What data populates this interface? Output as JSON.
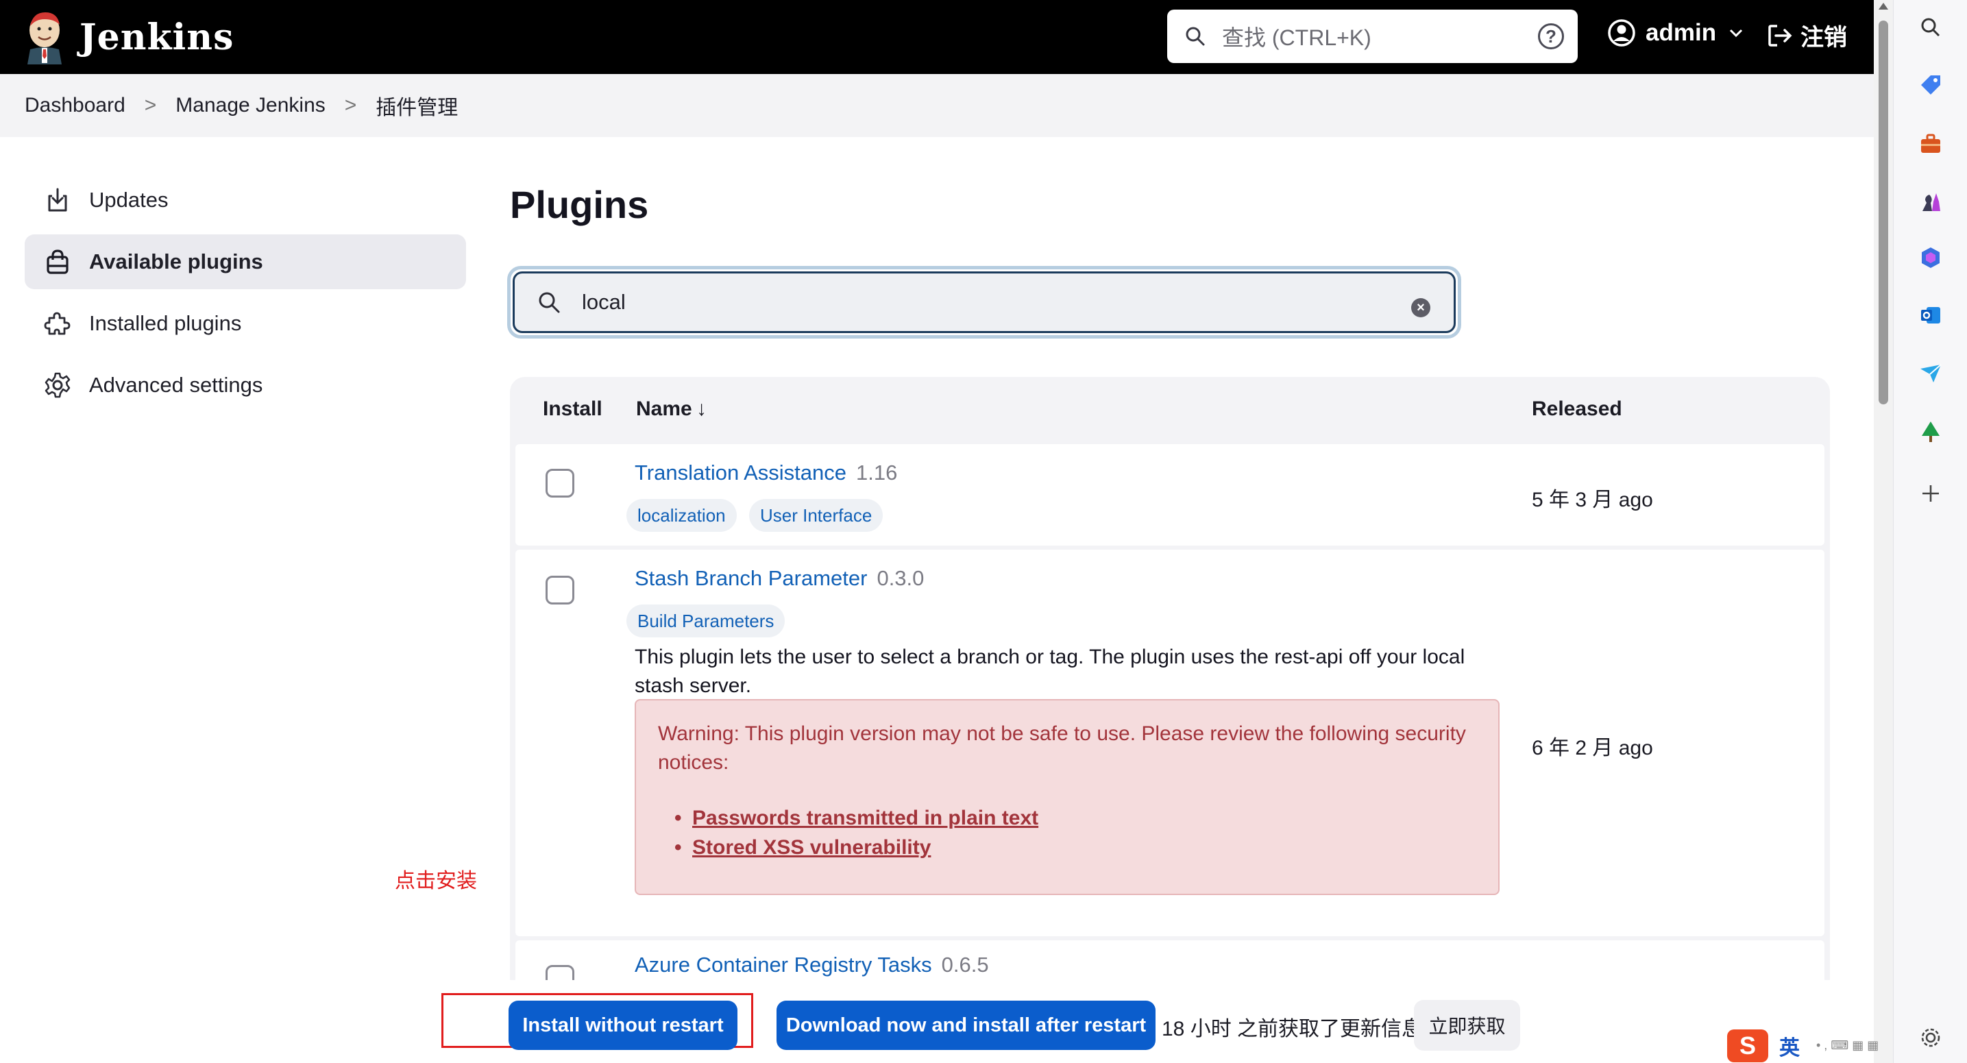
{
  "header": {
    "brand": "Jenkins",
    "search_placeholder": "查找 (CTRL+K)",
    "help_glyph": "?",
    "user": "admin",
    "logout": "注销"
  },
  "breadcrumb": [
    "Dashboard",
    "Manage Jenkins",
    "插件管理"
  ],
  "sidebar": [
    {
      "label": "Updates",
      "icon": "download-icon"
    },
    {
      "label": "Available plugins",
      "icon": "shopping-bag-icon",
      "active": true
    },
    {
      "label": "Installed plugins",
      "icon": "puzzle-icon"
    },
    {
      "label": "Advanced settings",
      "icon": "gear-icon"
    }
  ],
  "page": {
    "title": "Plugins",
    "filter_value": "local"
  },
  "table": {
    "headers": {
      "install": "Install",
      "name": "Name",
      "sort": "↓",
      "released": "Released"
    },
    "rows": [
      {
        "name": "Translation Assistance",
        "version": "1.16",
        "tags": [
          "localization",
          "User Interface"
        ],
        "released": "5 年 3 月 ago"
      },
      {
        "name": "Stash Branch Parameter",
        "version": "0.3.0",
        "tags": [
          "Build Parameters"
        ],
        "description": "This plugin lets the user to select a branch or tag. The plugin uses the rest-api off your local stash server.",
        "warning": "Warning: This plugin version may not be safe to use. Please review the following security notices:",
        "notices": [
          "Passwords transmitted in plain text",
          "Stored XSS vulnerability"
        ],
        "released": "6 年 2 月 ago"
      },
      {
        "name": "Azure Container Registry Tasks",
        "version": "0.6.5"
      }
    ]
  },
  "annotation": "点击安装",
  "actions": {
    "install_without_restart": "Install without restart",
    "download_install_after_restart": "Download now and install after restart",
    "last_fetched": "18 小时 之前获取了更新信息",
    "fetch_now": "立即获取"
  },
  "ime": {
    "logo": "S",
    "mode": "英"
  },
  "colors": {
    "accent": "#0b5dcc",
    "link": "#1160b6",
    "warning_bg": "#f5dcdd",
    "warning_text": "#a2343b",
    "annotation": "#e11d1d"
  }
}
